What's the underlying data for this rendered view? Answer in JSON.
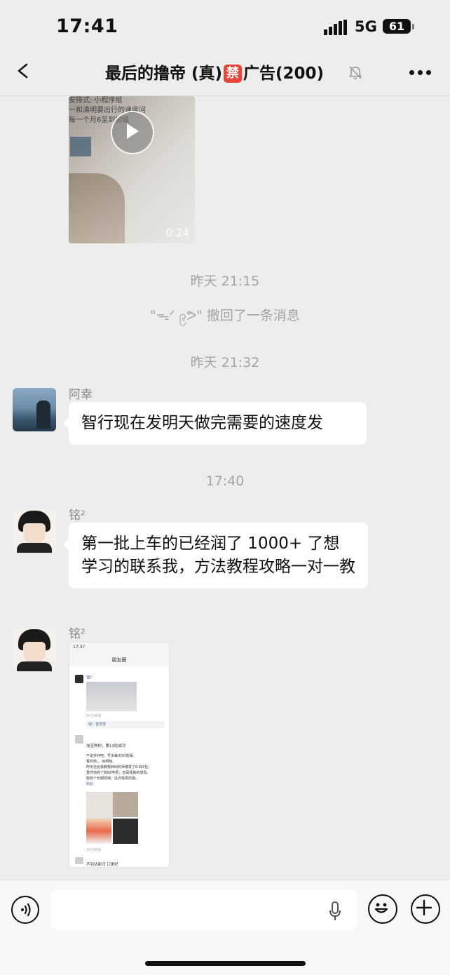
{
  "status_bar": {
    "time": "17:41",
    "network": "5G",
    "battery": "61"
  },
  "header": {
    "title_prefix": "最后的撸帝 (真)",
    "badge": "禁",
    "title_suffix": "广告(200)"
  },
  "video": {
    "duration": "0:24",
    "caption_lines": [
      "安排式: 小程序组",
      "一和清明要出行的速度问",
      "每一个月6至到初级"
    ]
  },
  "timestamps": [
    "昨天 21:15",
    "昨天 21:32",
    "17:40"
  ],
  "recall_notice": "\"ᯓᐟ ၉ᕗ\" 撤回了一条消息",
  "messages": [
    {
      "sender": "阿幸",
      "text": "智行现在发明天做完需要的速度发"
    },
    {
      "sender": "铭²",
      "text": "第一批上车的已经润了 1000+ 了想学习的联系我，方法教程攻略一对一教"
    },
    {
      "sender": "铭²"
    }
  ],
  "screenshot": {
    "time": "17:37",
    "page_title": "朋友圈",
    "post1_name": "铭²",
    "post1_meta": "20分钟前",
    "post1_like": "铭², 冒冒雪",
    "post2_line": "淘宝种树，第13轮成功",
    "post2_body": [
      "不说多好吧，号多每天50低保。",
      "香的哟。。哈啊哈。",
      "昨天还给我教我种树的师傅发了6.8红包。",
      "虽然他收了我68学费，但是我真的感恩。",
      "能有个长期低保，这点钱真的值。",
      "收起"
    ],
    "post2_meta": "30分钟前",
    "post3_name": "不到达新印 口更好"
  },
  "input_bar": {
    "placeholder": ""
  },
  "colors": {
    "background": "#ededed",
    "bubble": "#ffffff",
    "badge": "#e8453c",
    "timestamp": "#a4a4a4"
  }
}
